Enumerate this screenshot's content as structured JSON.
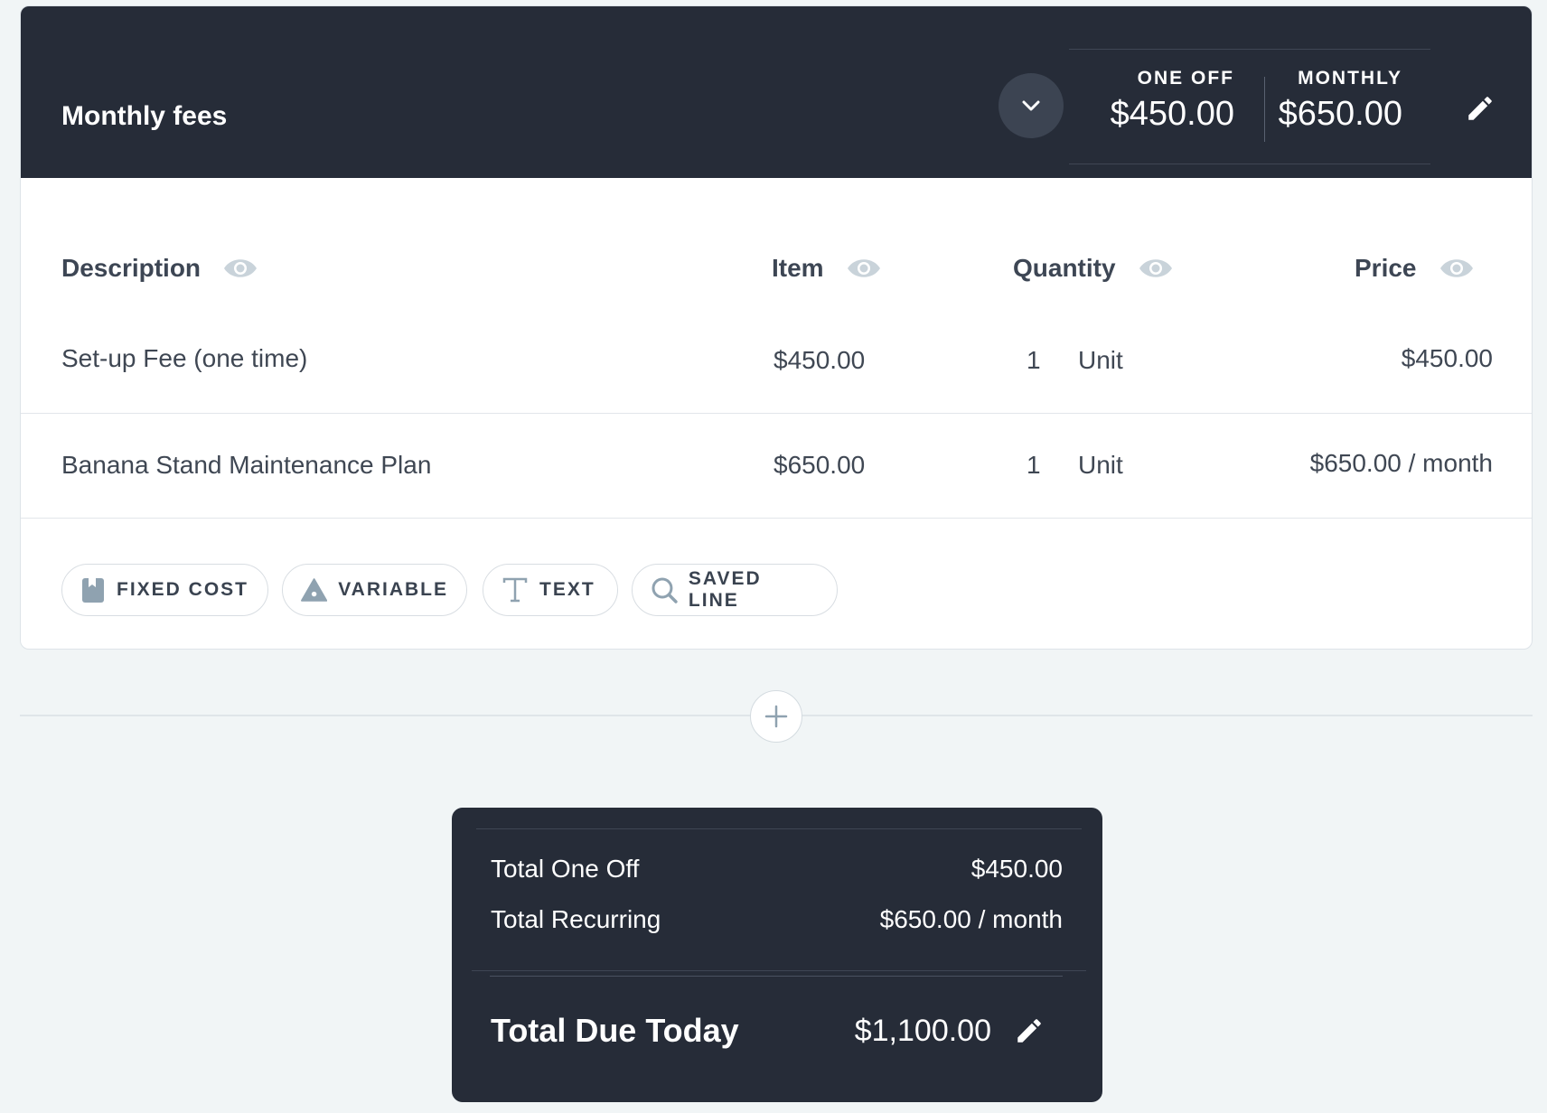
{
  "section": {
    "title": "Monthly fees",
    "one_off_label": "ONE OFF",
    "one_off_value": "$450.00",
    "monthly_label": "MONTHLY",
    "monthly_value": "$650.00"
  },
  "table": {
    "headers": [
      "Description",
      "Item",
      "Quantity",
      "Price"
    ],
    "rows": [
      {
        "description": "Set-up Fee (one time)",
        "item": "$450.00",
        "quantity": "1",
        "unit": "Unit",
        "price": "$450.00"
      },
      {
        "description": "Banana Stand Maintenance Plan",
        "item": "$650.00",
        "quantity": "1",
        "unit": "Unit",
        "price": "$650.00 / month"
      }
    ]
  },
  "add_buttons": [
    {
      "label": "FIXED COST",
      "icon": "bookmark-icon"
    },
    {
      "label": "VARIABLE",
      "icon": "triangle-icon"
    },
    {
      "label": "TEXT",
      "icon": "text-icon"
    },
    {
      "label": "SAVED LINE",
      "icon": "search-icon"
    }
  ],
  "summary": {
    "total_one_off_label": "Total One Off",
    "total_one_off_value": "$450.00",
    "total_recurring_label": "Total Recurring",
    "total_recurring_value": "$650.00 / month",
    "total_due_label": "Total Due Today",
    "total_due_value": "$1,100.00"
  },
  "colors": {
    "header_bg": "#262c38",
    "page_bg": "#f1f5f6",
    "icon_gray": "#8fa2b0"
  }
}
